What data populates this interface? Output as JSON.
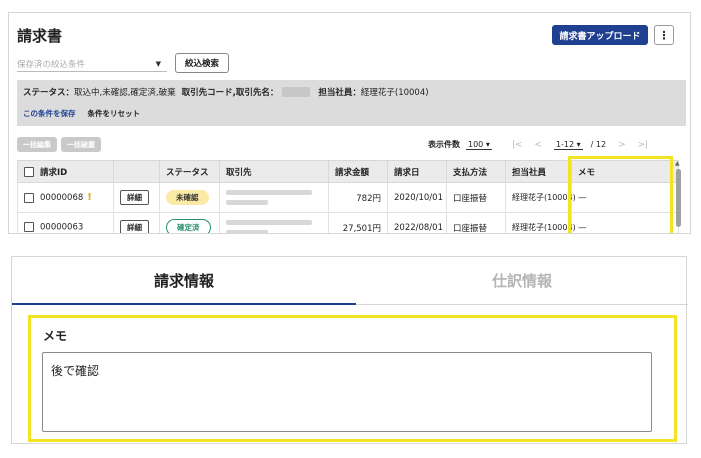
{
  "header": {
    "title": "請求書",
    "upload_label": "請求書アップロード",
    "more_label": "⋮"
  },
  "search": {
    "saved_placeholder": "保存済の絞込条件",
    "search_button": "絞込検索"
  },
  "filter": {
    "status_label": "ステータス：",
    "status_value": "取込中,未確認,確定済,破棄",
    "partner_label": "取引先コード,取引先名：",
    "staff_label": "担当社員：",
    "staff_value": "経理花子(10004)",
    "save_link": "この条件を保存",
    "reset_link": "条件をリセット"
  },
  "bulk": {
    "edit_label": "一括編集",
    "delete_label": "一括破棄"
  },
  "pager": {
    "per_page_label": "表示件数",
    "per_page_value": "100 ▾",
    "first": "|<",
    "prev": "<",
    "range": "1-12 ▾",
    "total": "/ 12",
    "next": ">",
    "last": ">|"
  },
  "table": {
    "columns": [
      "請求ID",
      "",
      "ステータス",
      "取引先",
      "請求金額",
      "請求日",
      "支払方法",
      "担当社員",
      "メモ"
    ],
    "rows": [
      {
        "id": "00000068",
        "warn": "!",
        "detail": "詳細",
        "status": "未確認",
        "amount": "782円",
        "date": "2020/10/01",
        "method": "口座振替",
        "staff": "経理花子(10004)",
        "memo": "—"
      },
      {
        "id": "00000063",
        "warn": "",
        "detail": "詳細",
        "status": "確定済",
        "amount": "27,501円",
        "date": "2022/08/01",
        "method": "口座振替",
        "staff": "経理花子(10004)",
        "memo": "—"
      }
    ]
  },
  "tabs": {
    "billing": "請求情報",
    "journal": "仕訳情報"
  },
  "memo": {
    "label": "メモ",
    "value": "後で確認"
  },
  "colors": {
    "primary": "#1f3f91",
    "highlight": "#f2e423",
    "pending_badge": "#fbeaa6",
    "done_badge": "#2a8f6f",
    "warning": "#e0a400"
  }
}
